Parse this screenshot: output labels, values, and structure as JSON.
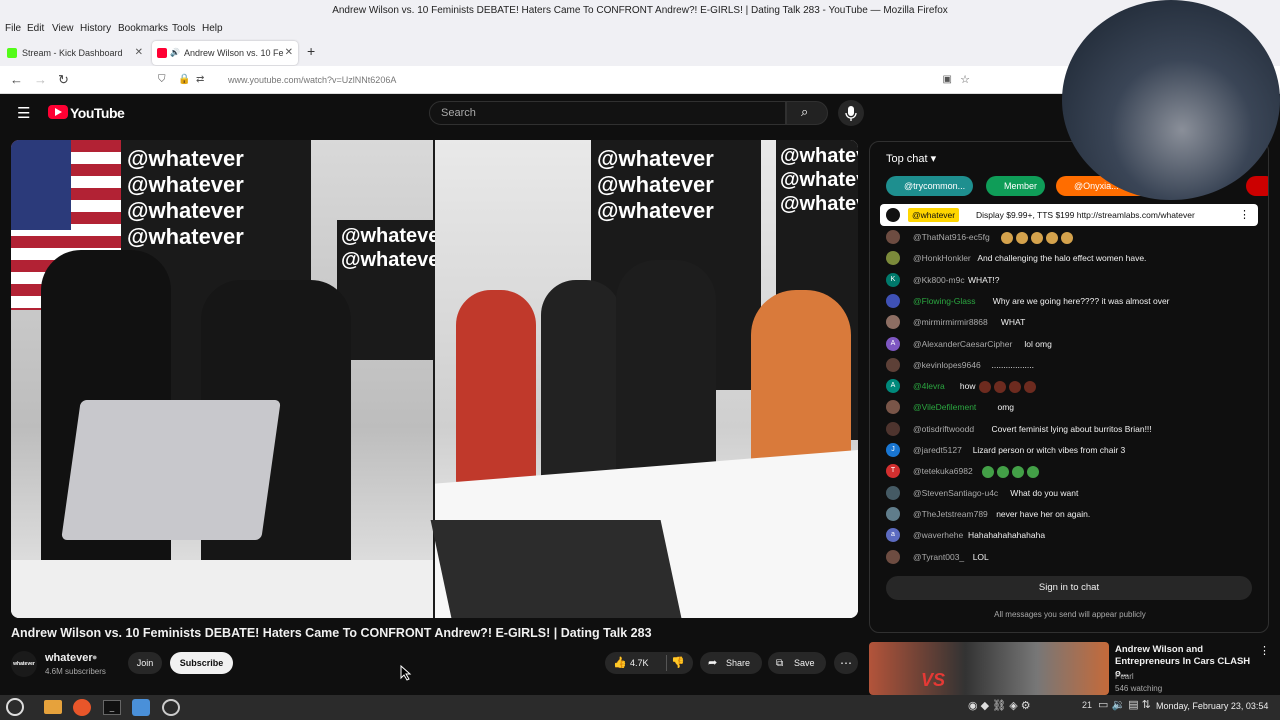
{
  "window": {
    "title": "Andrew Wilson vs. 10 Feminists DEBATE! Haters Came To CONFRONT Andrew?! E-GIRLS! | Dating Talk 283 - YouTube — Mozilla Firefox"
  },
  "menu": {
    "file": "File",
    "edit": "Edit",
    "view": "View",
    "history": "History",
    "bookmarks": "Bookmarks",
    "tools": "Tools",
    "help": "Help"
  },
  "tabs": [
    {
      "label": "Stream - Kick Dashboard",
      "icon": "kick-icon"
    },
    {
      "label": "Andrew Wilson vs. 10 Fe",
      "icon": "youtube-icon"
    }
  ],
  "url": "www.youtube.com/watch?v=UzlNNt6206A",
  "youtube": {
    "logo": "YouTube",
    "search_placeholder": "Search",
    "video_overlay_text": "@whatever",
    "video_title": "Andrew Wilson vs. 10 Feminists DEBATE! Haters Came To CONFRONT Andrew?! E-GIRLS! | Dating Talk 283",
    "channel": {
      "name": "whatever",
      "subscribers": "4.6M subscribers",
      "avatar_text": "whatever"
    },
    "join_label": "Join",
    "subscribe_label": "Subscribe",
    "likes": "4.7K",
    "share_label": "Share",
    "save_label": "Save"
  },
  "chat": {
    "header": "Top chat",
    "chips": [
      {
        "label": "@trycommon...",
        "color": "#1e8f8f"
      },
      {
        "label": "Member",
        "color": "#0f9d58"
      },
      {
        "label": "@Onyxia...",
        "color": "#ff6d00"
      }
    ],
    "pinned": {
      "author": "@whatever",
      "text": "Display $9.99+, TTS $199 http://streamlabs.com/whatever"
    },
    "messages": [
      {
        "author": "@ThatNat916-ec5fg",
        "text": "",
        "avatar_color": "#6d4c41",
        "avatar_letter": "",
        "emotes": 5
      },
      {
        "author": "@HonkHonkler",
        "text": "And challenging the halo effect women have.",
        "avatar_color": "#7b8a3a",
        "avatar_letter": "",
        "emotes": 0
      },
      {
        "author": "@Kk800-m9c",
        "text": "WHAT!?",
        "avatar_color": "#00796b",
        "avatar_letter": "K",
        "emotes": 0
      },
      {
        "author": "@Flowing-Glass",
        "text": "Why are we going here???? it was almost over",
        "avatar_color": "#3f51b5",
        "avatar_letter": "",
        "emotes": 0,
        "member": true
      },
      {
        "author": "@mirmirmirmir8868",
        "text": "WHAT",
        "avatar_color": "#8d6e63",
        "avatar_letter": "",
        "emotes": 0
      },
      {
        "author": "@AlexanderCaesarCipher",
        "text": "lol omg",
        "avatar_color": "#7e57c2",
        "avatar_letter": "A",
        "emotes": 0
      },
      {
        "author": "@kevinlopes9646",
        "text": "..................",
        "avatar_color": "#5d4037",
        "avatar_letter": "",
        "emotes": 0
      },
      {
        "author": "@4levra",
        "text": "how",
        "avatar_color": "#00897b",
        "avatar_letter": "A",
        "emotes": 4,
        "member": true
      },
      {
        "author": "@VileDefilement",
        "text": "omg",
        "avatar_color": "#795548",
        "avatar_letter": "",
        "emotes": 0,
        "member": true
      },
      {
        "author": "@otisdriftwoodd",
        "text": "Covert feminist lying about burritos Brian!!!",
        "avatar_color": "#4e342e",
        "avatar_letter": "",
        "emotes": 0
      },
      {
        "author": "@jaredt5127",
        "text": "Lizard person or witch vibes from chair 3",
        "avatar_color": "#1976d2",
        "avatar_letter": "J",
        "emotes": 0
      },
      {
        "author": "@tetekuka6982",
        "text": "",
        "avatar_color": "#d32f2f",
        "avatar_letter": "T",
        "emotes": 4
      },
      {
        "author": "@StevenSantiago-u4c",
        "text": "What do you want",
        "avatar_color": "#455a64",
        "avatar_letter": "",
        "emotes": 0
      },
      {
        "author": "@TheJetstream789",
        "text": "never have her on again.",
        "avatar_color": "#607d8b",
        "avatar_letter": "",
        "emotes": 0
      },
      {
        "author": "@waverhehe",
        "text": "Hahahahahahahaha",
        "avatar_color": "#5c6bc0",
        "avatar_letter": "a",
        "emotes": 0
      },
      {
        "author": "@Tyrant003_",
        "text": "LOL",
        "avatar_color": "#6d4c41",
        "avatar_letter": "",
        "emotes": 0
      }
    ],
    "sign_in_label": "Sign in to chat",
    "footer_note": "All messages you send will appear publicly"
  },
  "recommendation": {
    "title": "Andrew Wilson and Entrepreneurs In Cars CLASH o...",
    "channel": "Pearl",
    "meta": "546 watching"
  },
  "taskbar": {
    "clock": "Monday, February 23, 03:54",
    "tray_count": "21"
  }
}
